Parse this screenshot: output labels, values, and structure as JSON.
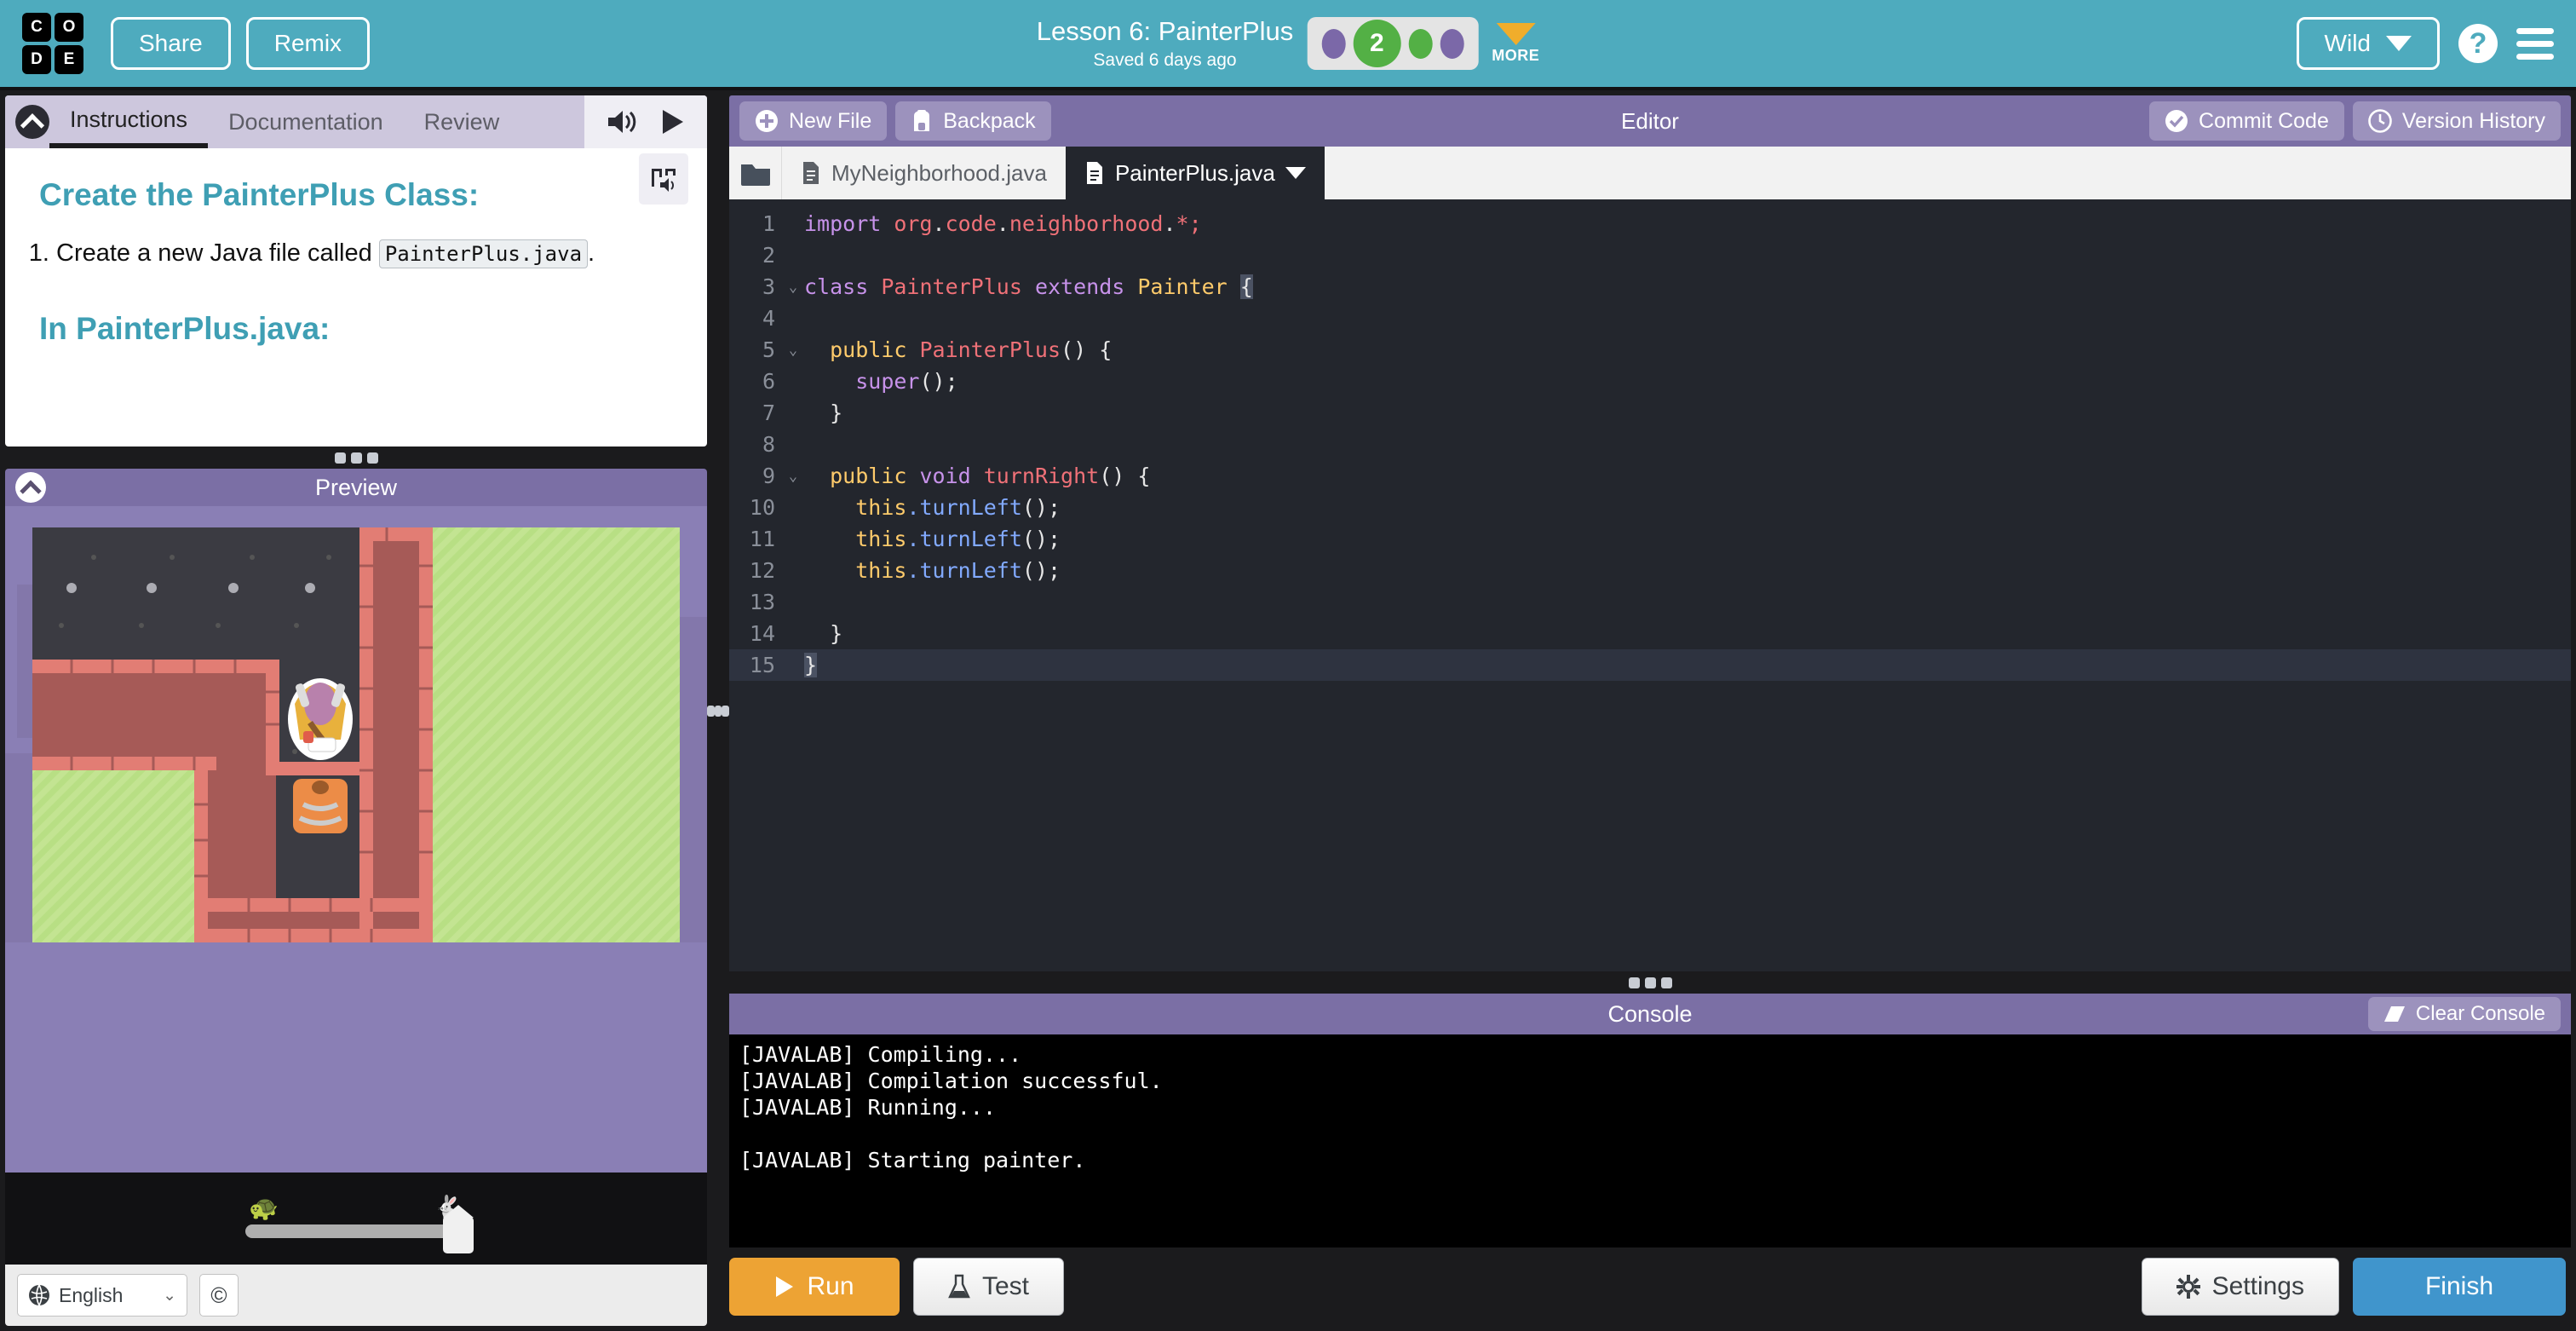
{
  "header": {
    "logo_letters": [
      "C",
      "O",
      "D",
      "E"
    ],
    "share_label": "Share",
    "remix_label": "Remix",
    "lesson_title": "Lesson 6: PainterPlus",
    "saved_status": "Saved 6 days ago",
    "current_level": "2",
    "more_label": "MORE",
    "user_menu_label": "Wild",
    "help_icon": "question-mark-icon",
    "menu_icon": "hamburger-icon",
    "bg_color": "#4eabbe"
  },
  "instructions": {
    "tabs": [
      {
        "label": "Instructions",
        "active": true
      },
      {
        "label": "Documentation",
        "active": false
      },
      {
        "label": "Review",
        "active": false
      }
    ],
    "speaker_icon": "speaker-icon",
    "play_icon": "play-icon",
    "tts_icon": "text-to-speech-icon",
    "heading": "Create the PainterPlus Class:",
    "step_1_before": "Create a new Java file called",
    "step_1_code": "PainterPlus.java",
    "step_1_after": ".",
    "heading2": "In PainterPlus.java:",
    "accent_color": "#3f9fb4"
  },
  "preview": {
    "title": "Preview",
    "collapse_icon": "chevron-up-icon",
    "speed_slow_icon": "turtle-icon",
    "speed_fast_icon": "rabbit-icon",
    "speed_value": 100,
    "language": "English",
    "language_icon": "globe-icon",
    "copyright_label": "©"
  },
  "editor": {
    "toolbar": {
      "new_file_label": "New File",
      "new_file_icon": "plus-circle-icon",
      "backpack_label": "Backpack",
      "backpack_icon": "backpack-icon",
      "title": "Editor",
      "commit_label": "Commit Code",
      "commit_icon": "check-circle-icon",
      "version_label": "Version History",
      "version_icon": "clock-icon"
    },
    "folder_icon": "folder-icon",
    "file_tabs": [
      {
        "name": "MyNeighborhood.java",
        "active": false,
        "icon": "file-icon"
      },
      {
        "name": "PainterPlus.java",
        "active": true,
        "icon": "file-icon",
        "has_dropdown": true
      }
    ],
    "lines": [
      {
        "n": "1",
        "fold": false,
        "active": false,
        "tokens": [
          {
            "t": "import ",
            "c": "k"
          },
          {
            "t": "org",
            "c": "id"
          },
          {
            "t": ".",
            "c": "p"
          },
          {
            "t": "code",
            "c": "id"
          },
          {
            "t": ".",
            "c": "p"
          },
          {
            "t": "neighborhood",
            "c": "id"
          },
          {
            "t": ".",
            "c": "p"
          },
          {
            "t": "*;",
            "c": "id"
          }
        ]
      },
      {
        "n": "2",
        "fold": false,
        "active": false,
        "tokens": []
      },
      {
        "n": "3",
        "fold": true,
        "active": false,
        "tokens": [
          {
            "t": "class ",
            "c": "k"
          },
          {
            "t": "PainterPlus",
            "c": "id"
          },
          {
            "t": " ",
            "c": "p"
          },
          {
            "t": "extends ",
            "c": "k"
          },
          {
            "t": "Painter",
            "c": "t"
          },
          {
            "t": " ",
            "c": "p"
          },
          {
            "t": "{",
            "c": "cur"
          }
        ]
      },
      {
        "n": "4",
        "fold": false,
        "active": false,
        "tokens": []
      },
      {
        "n": "5",
        "fold": true,
        "active": false,
        "tokens": [
          {
            "t": "  ",
            "c": "p"
          },
          {
            "t": "public ",
            "c": "t"
          },
          {
            "t": "PainterPlus",
            "c": "id"
          },
          {
            "t": "() {",
            "c": "p"
          }
        ]
      },
      {
        "n": "6",
        "fold": false,
        "active": false,
        "tokens": [
          {
            "t": "    ",
            "c": "p"
          },
          {
            "t": "super",
            "c": "k"
          },
          {
            "t": "();",
            "c": "p"
          }
        ]
      },
      {
        "n": "7",
        "fold": false,
        "active": false,
        "tokens": [
          {
            "t": "  }",
            "c": "p"
          }
        ]
      },
      {
        "n": "8",
        "fold": false,
        "active": false,
        "tokens": []
      },
      {
        "n": "9",
        "fold": true,
        "active": false,
        "tokens": [
          {
            "t": "  ",
            "c": "p"
          },
          {
            "t": "public ",
            "c": "t"
          },
          {
            "t": "void ",
            "c": "k"
          },
          {
            "t": "turnRight",
            "c": "id"
          },
          {
            "t": "() {",
            "c": "p"
          }
        ]
      },
      {
        "n": "10",
        "fold": false,
        "active": false,
        "tokens": [
          {
            "t": "    ",
            "c": "p"
          },
          {
            "t": "this",
            "c": "t"
          },
          {
            "t": ".",
            "c": "m"
          },
          {
            "t": "turnLeft",
            "c": "m"
          },
          {
            "t": "();",
            "c": "p"
          }
        ]
      },
      {
        "n": "11",
        "fold": false,
        "active": false,
        "tokens": [
          {
            "t": "    ",
            "c": "p"
          },
          {
            "t": "this",
            "c": "t"
          },
          {
            "t": ".",
            "c": "m"
          },
          {
            "t": "turnLeft",
            "c": "m"
          },
          {
            "t": "();",
            "c": "p"
          }
        ]
      },
      {
        "n": "12",
        "fold": false,
        "active": false,
        "tokens": [
          {
            "t": "    ",
            "c": "p"
          },
          {
            "t": "this",
            "c": "t"
          },
          {
            "t": ".",
            "c": "m"
          },
          {
            "t": "turnLeft",
            "c": "m"
          },
          {
            "t": "();",
            "c": "p"
          }
        ]
      },
      {
        "n": "13",
        "fold": false,
        "active": false,
        "tokens": []
      },
      {
        "n": "14",
        "fold": false,
        "active": false,
        "tokens": [
          {
            "t": "  }",
            "c": "p"
          }
        ]
      },
      {
        "n": "15",
        "fold": false,
        "active": true,
        "tokens": [
          {
            "t": "}",
            "c": "cur"
          }
        ]
      }
    ]
  },
  "console": {
    "title": "Console",
    "clear_label": "Clear Console",
    "clear_icon": "eraser-icon",
    "lines": [
      "[JAVALAB] Compiling...",
      "[JAVALAB] Compilation successful.",
      "[JAVALAB] Running...",
      "",
      "[JAVALAB] Starting painter."
    ]
  },
  "bottom_bar": {
    "run_label": "Run",
    "run_icon": "play-icon",
    "test_label": "Test",
    "test_icon": "flask-icon",
    "settings_label": "Settings",
    "settings_icon": "gear-icon",
    "finish_label": "Finish",
    "run_color": "#eda334",
    "finish_color": "#4095cc"
  }
}
